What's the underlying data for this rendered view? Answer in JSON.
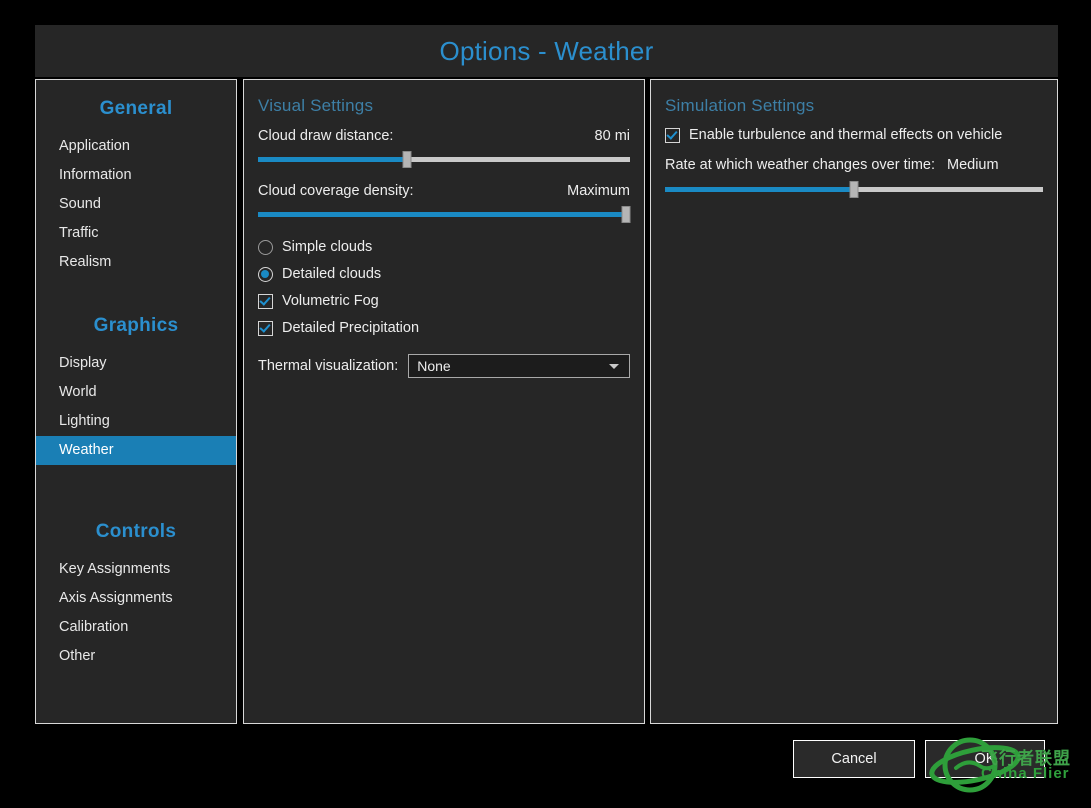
{
  "window": {
    "title": "Options - Weather",
    "accent_color": "#2b8fce",
    "panel_bg": "#262626",
    "highlight_color": "#1a7fb5"
  },
  "sidebar": {
    "groups": [
      {
        "title": "General",
        "items": [
          {
            "label": "Application",
            "selected": false
          },
          {
            "label": "Information",
            "selected": false
          },
          {
            "label": "Sound",
            "selected": false
          },
          {
            "label": "Traffic",
            "selected": false
          },
          {
            "label": "Realism",
            "selected": false
          }
        ]
      },
      {
        "title": "Graphics",
        "items": [
          {
            "label": "Display",
            "selected": false
          },
          {
            "label": "World",
            "selected": false
          },
          {
            "label": "Lighting",
            "selected": false
          },
          {
            "label": "Weather",
            "selected": true
          }
        ]
      },
      {
        "title": "Controls",
        "items": [
          {
            "label": "Key Assignments",
            "selected": false
          },
          {
            "label": "Axis Assignments",
            "selected": false
          },
          {
            "label": "Calibration",
            "selected": false
          },
          {
            "label": "Other",
            "selected": false
          }
        ]
      }
    ]
  },
  "visual_settings": {
    "heading": "Visual Settings",
    "cloud_draw_distance": {
      "label": "Cloud draw distance:",
      "value": "80 mi",
      "percent": 40
    },
    "cloud_coverage_density": {
      "label": "Cloud coverage density:",
      "value": "Maximum",
      "percent": 99
    },
    "cloud_mode": {
      "options": [
        {
          "label": "Simple clouds",
          "selected": false
        },
        {
          "label": "Detailed clouds",
          "selected": true
        }
      ]
    },
    "checkboxes": [
      {
        "label": "Volumetric Fog",
        "checked": true
      },
      {
        "label": "Detailed Precipitation",
        "checked": true
      }
    ],
    "thermal_visualization": {
      "label": "Thermal visualization:",
      "value": "None"
    }
  },
  "simulation_settings": {
    "heading": "Simulation Settings",
    "turbulence": {
      "label": "Enable turbulence and thermal effects on vehicle",
      "checked": true
    },
    "weather_rate": {
      "label": "Rate at which weather changes over time:",
      "value": "Medium",
      "percent": 50
    }
  },
  "footer": {
    "cancel_label": "Cancel",
    "ok_label": "OK"
  },
  "watermark": {
    "text_cn": "飞行者联盟",
    "text_en": "China Flier",
    "color": "#3fa34a"
  }
}
